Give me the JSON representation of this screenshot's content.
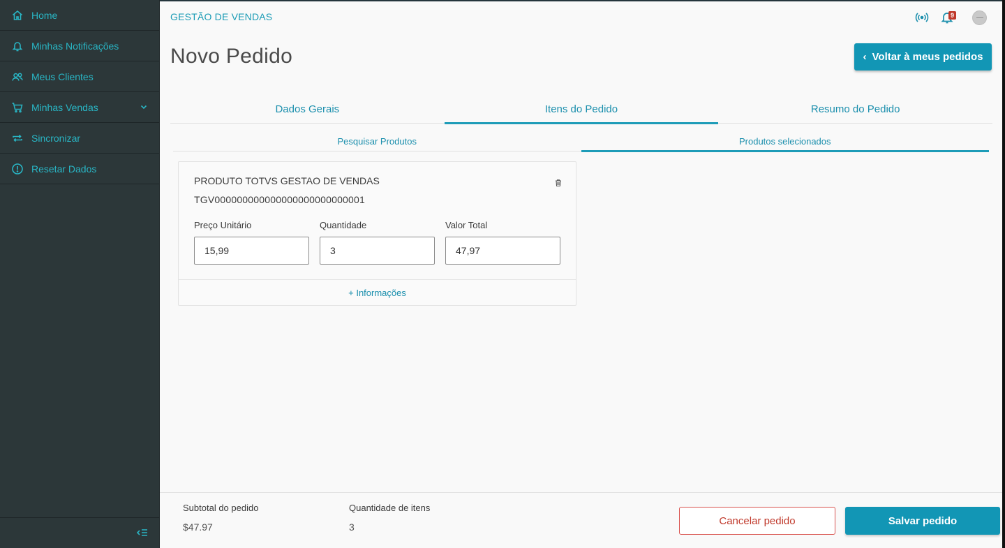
{
  "sidebar": {
    "items": [
      {
        "label": "Home",
        "icon": "home-icon"
      },
      {
        "label": "Minhas Notificações",
        "icon": "bell-icon"
      },
      {
        "label": "Meus Clientes",
        "icon": "users-icon"
      },
      {
        "label": "Minhas Vendas",
        "icon": "cart-icon"
      },
      {
        "label": "Sincronizar",
        "icon": "sync-icon"
      },
      {
        "label": "Resetar Dados",
        "icon": "alert-circle-icon"
      }
    ]
  },
  "header": {
    "app_title": "GESTÃO DE VENDAS",
    "notification_count": "9",
    "page_title": "Novo Pedido",
    "back_button_label": "Voltar à meus pedidos"
  },
  "tabs": [
    {
      "label": "Dados Gerais"
    },
    {
      "label": "Itens do Pedido"
    },
    {
      "label": "Resumo do Pedido"
    }
  ],
  "subtabs": [
    {
      "label": "Pesquisar Produtos"
    },
    {
      "label": "Produtos selecionados"
    }
  ],
  "product": {
    "name": "PRODUTO TOTVS GESTAO DE VENDAS",
    "code": "TGV000000000000000000000000001",
    "price_label": "Preço Unitário",
    "price_value": "15,99",
    "qty_label": "Quantidade",
    "qty_value": "3",
    "total_label": "Valor Total",
    "total_value": "47,97",
    "more_info": "+ Informações"
  },
  "footer": {
    "subtotal_label": "Subtotal do pedido",
    "subtotal_value": "$47.97",
    "items_label": "Quantidade de itens",
    "items_value": "3",
    "cancel_label": "Cancelar pedido",
    "save_label": "Salvar pedido"
  },
  "colors": {
    "accent": "#1296b5",
    "sidebar_bg": "#2c3739",
    "sidebar_text": "#29b6c5",
    "danger": "#c0392b"
  }
}
